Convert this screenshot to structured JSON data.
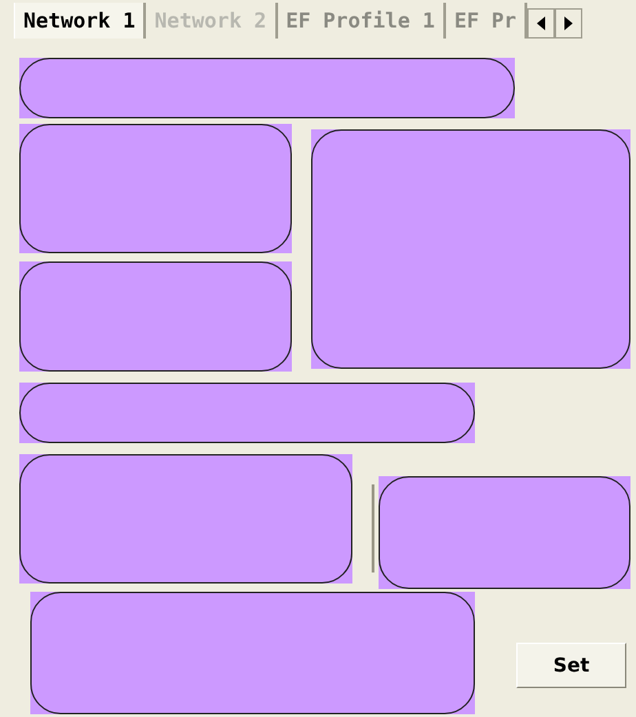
{
  "tabs": [
    {
      "label": "Network 1",
      "selected": true,
      "disabled": false
    },
    {
      "label": "Network 2",
      "selected": false,
      "disabled": true
    },
    {
      "label": "EF Profile 1",
      "selected": false,
      "disabled": false
    },
    {
      "label": "EF Pr",
      "selected": false,
      "disabled": false
    }
  ],
  "button": "Set"
}
